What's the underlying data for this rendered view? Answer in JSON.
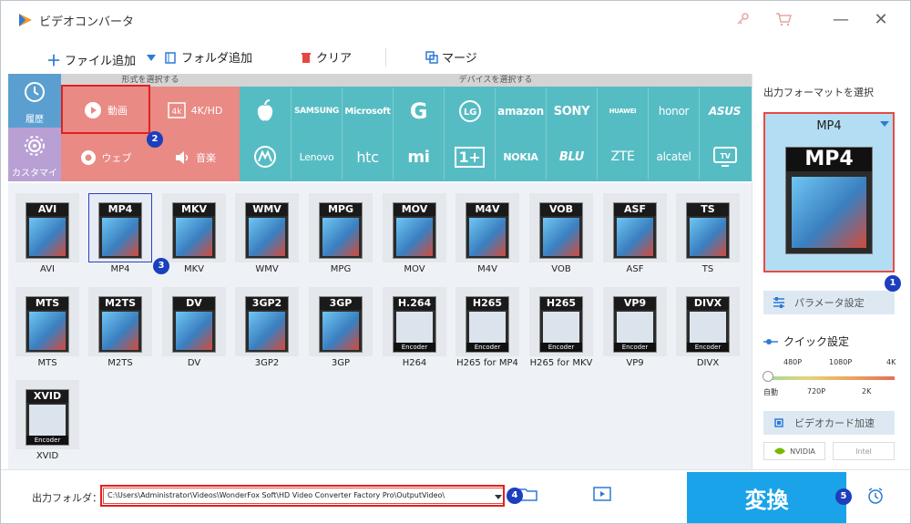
{
  "window": {
    "title": "ビデオコンバータ",
    "minimize": "—",
    "close": "✕"
  },
  "toolbar": {
    "add_file": "ファイル追加",
    "add_folder": "フォルダ追加",
    "clear": "クリア",
    "merge": "マージ"
  },
  "format_section": {
    "header": "形式を選択する",
    "history": "履歴",
    "custom": "カスタマイズ"
  },
  "categories": [
    {
      "label": "動画",
      "icon": "play-icon"
    },
    {
      "label": "4K/HD",
      "icon": "4k-icon"
    },
    {
      "label": "ウェブ",
      "icon": "chrome-icon"
    },
    {
      "label": "音楽",
      "icon": "speaker-icon"
    }
  ],
  "device_section": {
    "header": "デバイスを選択する"
  },
  "brands_row1": [
    "",
    "SAMSUNG",
    "Microsoft",
    "G",
    "LG",
    "amazon",
    "SONY",
    "HUAWEI",
    "honor",
    "ASUS"
  ],
  "brands_row2": [
    "",
    "Lenovo",
    "htc",
    "mi",
    "1+",
    "NOKIA",
    "BLU",
    "ZTE",
    "alcatel",
    "TV"
  ],
  "formats_row1": [
    {
      "tag": "AVI",
      "name": "AVI"
    },
    {
      "tag": "MP4",
      "name": "MP4"
    },
    {
      "tag": "MKV",
      "name": "MKV"
    },
    {
      "tag": "WMV",
      "name": "WMV"
    },
    {
      "tag": "MPG",
      "name": "MPG"
    },
    {
      "tag": "MOV",
      "name": "MOV"
    },
    {
      "tag": "M4V",
      "name": "M4V"
    },
    {
      "tag": "VOB",
      "name": "VOB"
    },
    {
      "tag": "ASF",
      "name": "ASF"
    },
    {
      "tag": "TS",
      "name": "TS"
    }
  ],
  "formats_row2": [
    {
      "tag": "MTS",
      "name": "MTS"
    },
    {
      "tag": "M2TS",
      "name": "M2TS"
    },
    {
      "tag": "DV",
      "name": "DV"
    },
    {
      "tag": "3GP2",
      "name": "3GP2"
    },
    {
      "tag": "3GP",
      "name": "3GP"
    },
    {
      "tag": "H.264",
      "name": "H264"
    },
    {
      "tag": "H265",
      "name": "H265 for MP4"
    },
    {
      "tag": "H265",
      "name": "H265 for MKV"
    },
    {
      "tag": "VP9",
      "name": "VP9"
    },
    {
      "tag": "DIVX",
      "name": "DIVX"
    }
  ],
  "formats_row3": [
    {
      "tag": "XVID",
      "name": "XVID"
    }
  ],
  "encoder_label": "Encoder",
  "output_panel": {
    "header": "出力フォーマットを選択",
    "format": "MP4",
    "param_button": "パラメータ設定",
    "quick_settings": "クイック設定",
    "quality_top": [
      "480P",
      "1080P",
      "4K"
    ],
    "quality_bottom": [
      "自動",
      "720P",
      "2K"
    ],
    "quality_level": 0,
    "gpu_button": "ビデオカード加速",
    "nvidia": "NVIDIA",
    "intel": "Intel"
  },
  "output_folder": {
    "label": "出力フォルダ：",
    "path": "C:\\Users\\Administrator\\Videos\\WonderFox Soft\\HD Video Converter Factory Pro\\OutputVideo\\"
  },
  "convert_button": "変換",
  "badges": [
    "1",
    "2",
    "3",
    "4",
    "5"
  ],
  "colors": {
    "accent": "#1aa3e8",
    "format_tile": "#e98a84",
    "device_tile": "#56bcc3",
    "badge": "#1b3fbd",
    "highlight": "#e02020"
  }
}
